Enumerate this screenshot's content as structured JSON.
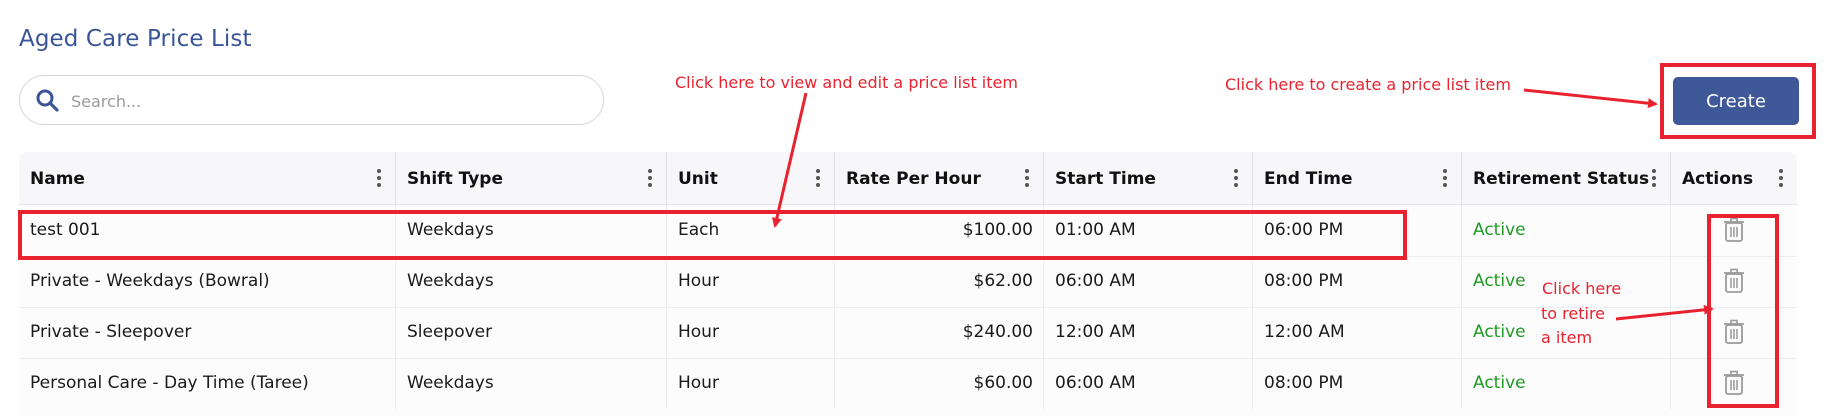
{
  "page": {
    "title": "Aged Care Price List"
  },
  "search": {
    "placeholder": "Search...",
    "value": ""
  },
  "toolbar": {
    "create_label": "Create"
  },
  "colors": {
    "brand": "#3f5897",
    "active": "#1e9a22",
    "annotation": "#e8232f"
  },
  "table": {
    "columns": [
      "Name",
      "Shift Type",
      "Unit",
      "Rate Per Hour",
      "Start Time",
      "End Time",
      "Retirement Status",
      "Actions"
    ],
    "rows": [
      {
        "name": "test 001",
        "shift_type": "Weekdays",
        "unit": "Each",
        "rate": "$100.00",
        "start": "01:00 AM",
        "end": "06:00 PM",
        "status": "Active",
        "action_icon": "trash-icon"
      },
      {
        "name": "Private - Weekdays (Bowral)",
        "shift_type": "Weekdays",
        "unit": "Hour",
        "rate": "$62.00",
        "start": "06:00 AM",
        "end": "08:00 PM",
        "status": "Active",
        "action_icon": "trash-icon"
      },
      {
        "name": "Private - Sleepover",
        "shift_type": "Sleepover",
        "unit": "Hour",
        "rate": "$240.00",
        "start": "12:00 AM",
        "end": "12:00 AM",
        "status": "Active",
        "action_icon": "trash-icon"
      },
      {
        "name": "Personal Care - Day Time (Taree)",
        "shift_type": "Weekdays",
        "unit": "Hour",
        "rate": "$60.00",
        "start": "06:00 AM",
        "end": "08:00 PM",
        "status": "Active",
        "action_icon": "trash-icon"
      }
    ]
  },
  "annotations": {
    "view_edit": "Click here to view and edit a price list item",
    "create": "Click here to create a price list item",
    "retire_line1": "Click here",
    "retire_line2": "to retire",
    "retire_line3": "a item"
  }
}
